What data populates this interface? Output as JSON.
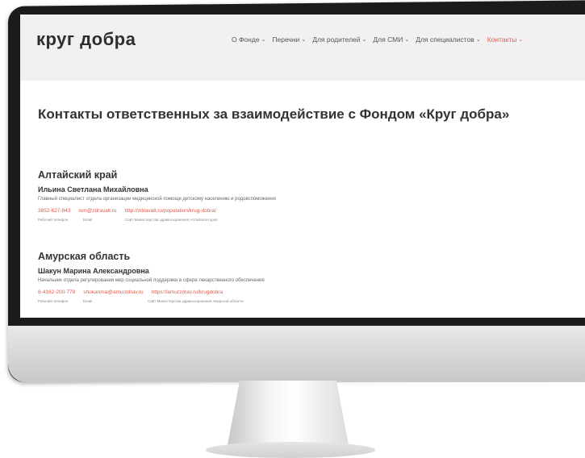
{
  "site": {
    "logo": "круг добра",
    "nav": [
      {
        "label": "О Фонде",
        "active": false
      },
      {
        "label": "Перечни",
        "active": false
      },
      {
        "label": "Для родителей",
        "active": false
      },
      {
        "label": "Для СМИ",
        "active": false
      },
      {
        "label": "Для специалистов",
        "active": false
      },
      {
        "label": "Контакты",
        "active": true
      }
    ],
    "page_title": "Контакты ответственных за взаимодействие с Фондом «Круг добра»"
  },
  "contacts": [
    {
      "region": "Алтайский край",
      "person": "Ильина Светлана Михайловна",
      "role": "Главный специалист отдела организации медицинской помощи детскому населению и родовспоможения",
      "phone": "3852-627-843",
      "email": "ism@zdravalt.ru",
      "website": "http://zdravalt.ru/population/krug-dobra/",
      "phone_caption": "Рабочий телефон",
      "email_caption": "Email",
      "website_caption": "Сайт Министерства здравоохранения Алтайского края"
    },
    {
      "region": "Амурская область",
      "person": "Шакун Марина Александровна",
      "role": "Начальник отдела регулирования мер социальной поддержки в сфере лекарственного обеспечения",
      "phone": "8-4162-200-778",
      "email": "shukanma@amurzdrav.ru",
      "website": "https://amurzdrav.ru/krugdobra",
      "phone_caption": "Рабочий телефон",
      "email_caption": "Email",
      "website_caption": "Сайт Министерства здравоохранения Амурской области"
    }
  ],
  "colors": {
    "accent": "#e05c4f",
    "text": "#333333",
    "topbar": "#f1f1f1"
  }
}
